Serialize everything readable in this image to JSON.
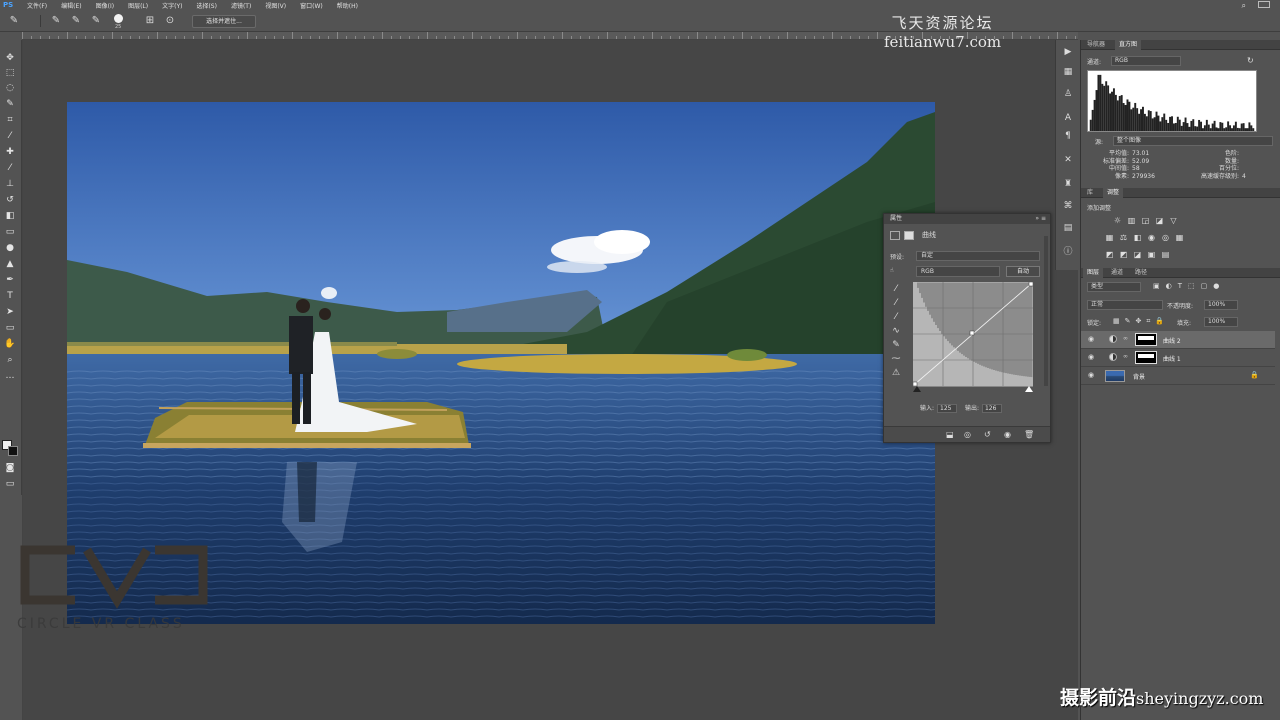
{
  "app": {
    "logo": "PS"
  },
  "menu": [
    "文件(F)",
    "编辑(E)",
    "图像(I)",
    "图层(L)",
    "文字(Y)",
    "选择(S)",
    "滤镜(T)",
    "视图(V)",
    "窗口(W)",
    "帮助(H)"
  ],
  "options_bar": {
    "brush_size": "25",
    "select_button": "选择并遮住..."
  },
  "watermark_top": {
    "cn": "飞天资源论坛",
    "url": "feitianwu7.com"
  },
  "logo_overlay": {
    "text": "CIRCLE VR CLASS"
  },
  "properties_panel": {
    "title": "属性",
    "curve_label": "曲线",
    "preset_label": "预设:",
    "preset_value": "自定",
    "channel_value": "RGB",
    "auto_button": "自动",
    "input_label": "输入:",
    "input_value": "125",
    "output_label": "输出:",
    "output_value": "126"
  },
  "histogram_panel": {
    "tabs": [
      "导航器",
      "直方图"
    ],
    "channel_label": "通道:",
    "channel_value": "RGB",
    "source_label": "源:",
    "source_value": "整个图像",
    "stats": {
      "mean_label": "平均值:",
      "mean": "73.01",
      "std_label": "标准偏差:",
      "std": "52.09",
      "median_label": "中间值:",
      "median": "58",
      "pixels_label": "像素:",
      "pixels": "279936",
      "level_label": "色阶:",
      "count_label": "数量:",
      "percentile_label": "百分位:",
      "cache_label": "高速缓存级别:",
      "cache": "4"
    }
  },
  "adjustments_panel": {
    "tabs": [
      "库",
      "调整"
    ],
    "title": "添加调整"
  },
  "layers_panel": {
    "tabs": [
      "图层",
      "通道",
      "路径"
    ],
    "filter": "类型",
    "blend_mode": "正常",
    "opacity_label": "不透明度:",
    "opacity": "100%",
    "lock_label": "锁定:",
    "fill_label": "填充:",
    "fill": "100%",
    "layers": [
      {
        "name": "曲线 2",
        "selected": true
      },
      {
        "name": "曲线 1",
        "selected": false
      },
      {
        "name": "背景",
        "selected": false
      }
    ]
  },
  "bottom_watermark": {
    "cn": "摄影前沿",
    "url": "sheyingzyz.com"
  }
}
